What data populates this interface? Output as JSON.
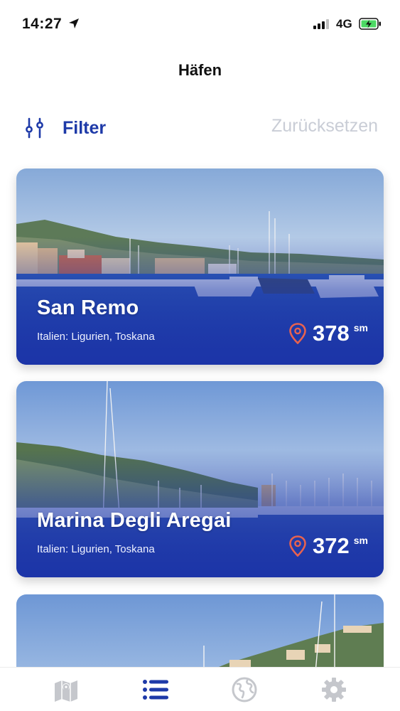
{
  "status": {
    "time": "14:27",
    "network": "4G",
    "location_icon": "location-arrow-icon",
    "signal_bars_active": 3,
    "battery_icon": "battery-charging-icon"
  },
  "header": {
    "title": "Häfen"
  },
  "filter_bar": {
    "filter_label": "Filter",
    "filter_icon": "filter-sliders-icon",
    "reset_label": "Zurücksetzen"
  },
  "harbors": [
    {
      "name": "San Remo",
      "region": "Italien: Ligurien, Toskana",
      "distance": "378",
      "unit": "sm"
    },
    {
      "name": "Marina Degli Aregai",
      "region": "Italien: Ligurien, Toskana",
      "distance": "372",
      "unit": "sm"
    }
  ],
  "tabs": [
    {
      "name": "map",
      "icon": "map-icon",
      "active": false
    },
    {
      "name": "list",
      "icon": "list-icon",
      "active": true
    },
    {
      "name": "globe",
      "icon": "globe-icon",
      "active": false
    },
    {
      "name": "settings",
      "icon": "gear-icon",
      "active": false
    }
  ],
  "colors": {
    "accent": "#1e3aa8",
    "inactive_icon": "#c5c7cc",
    "reset_text": "#c9cdd6",
    "pin": "#e8624f"
  }
}
